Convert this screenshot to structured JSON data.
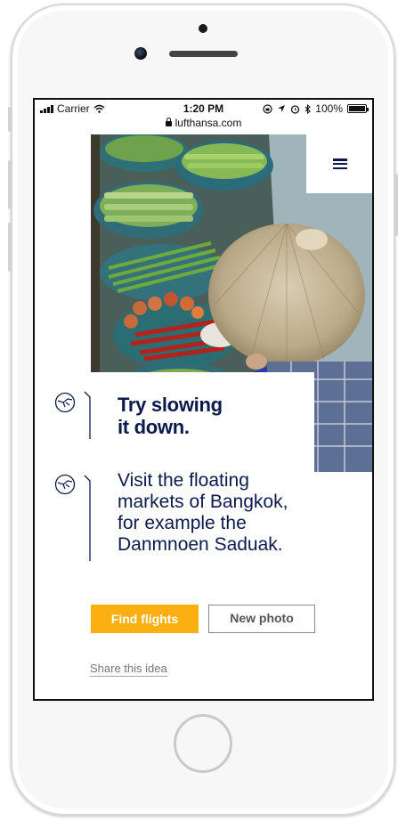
{
  "status_bar": {
    "carrier": "Carrier",
    "time": "1:20 PM",
    "battery": "100%",
    "battery_level": 1.0
  },
  "browser": {
    "url": "lufthansa.com"
  },
  "header": {
    "menu_icon": "hamburger-icon"
  },
  "content": {
    "headline_line1": "Try slowing",
    "headline_line2": "it down.",
    "body_line1": "Visit the floating",
    "body_line2": "markets of Bangkok,",
    "body_line3": "for example the",
    "body_line4": "Danmnoen Saduak.",
    "logo_icon": "crane-logo-icon"
  },
  "actions": {
    "find_flights": "Find flights",
    "new_photo": "New photo",
    "share": "Share this idea"
  },
  "colors": {
    "brand_navy": "#0b1a4d",
    "accent_yellow": "#fcaf10"
  }
}
